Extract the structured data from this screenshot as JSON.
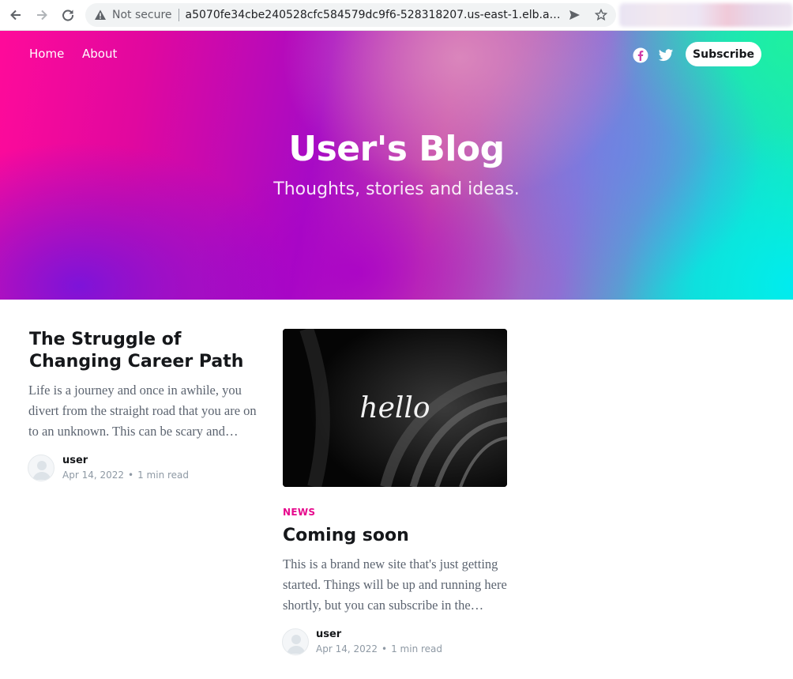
{
  "browser": {
    "security_label": "Not secure",
    "url": "a5070fe34cbe240528cfc584579dc9f6-528318207.us-east-1.elb.amazona..."
  },
  "site": {
    "nav": [
      {
        "label": "Home"
      },
      {
        "label": "About"
      }
    ],
    "subscribe_label": "Subscribe",
    "title": "User's Blog",
    "subtitle": "Thoughts, stories and ideas.",
    "social": [
      {
        "icon": "facebook-icon"
      },
      {
        "icon": "twitter-icon"
      }
    ],
    "accent_color": "#e6088c"
  },
  "posts": [
    {
      "title_line1": "The Struggle of",
      "title_line2": "Changing Career Path",
      "excerpt_lines": [
        "Life is a journey and once in awhile, you",
        "divert from the straight road that you are on",
        "to an unknown. This can be scary and…"
      ],
      "author": "user",
      "date": "Apr 14, 2022",
      "read_time": "1 min read"
    },
    {
      "image_text": "hello",
      "tag": "NEWS",
      "title": "Coming soon",
      "excerpt_lines": [
        "This is a brand new site that's just getting",
        "started. Things will be up and running here",
        "shortly, but you can subscribe in the…"
      ],
      "author": "user",
      "date": "Apr 14, 2022",
      "read_time": "1 min read"
    }
  ]
}
